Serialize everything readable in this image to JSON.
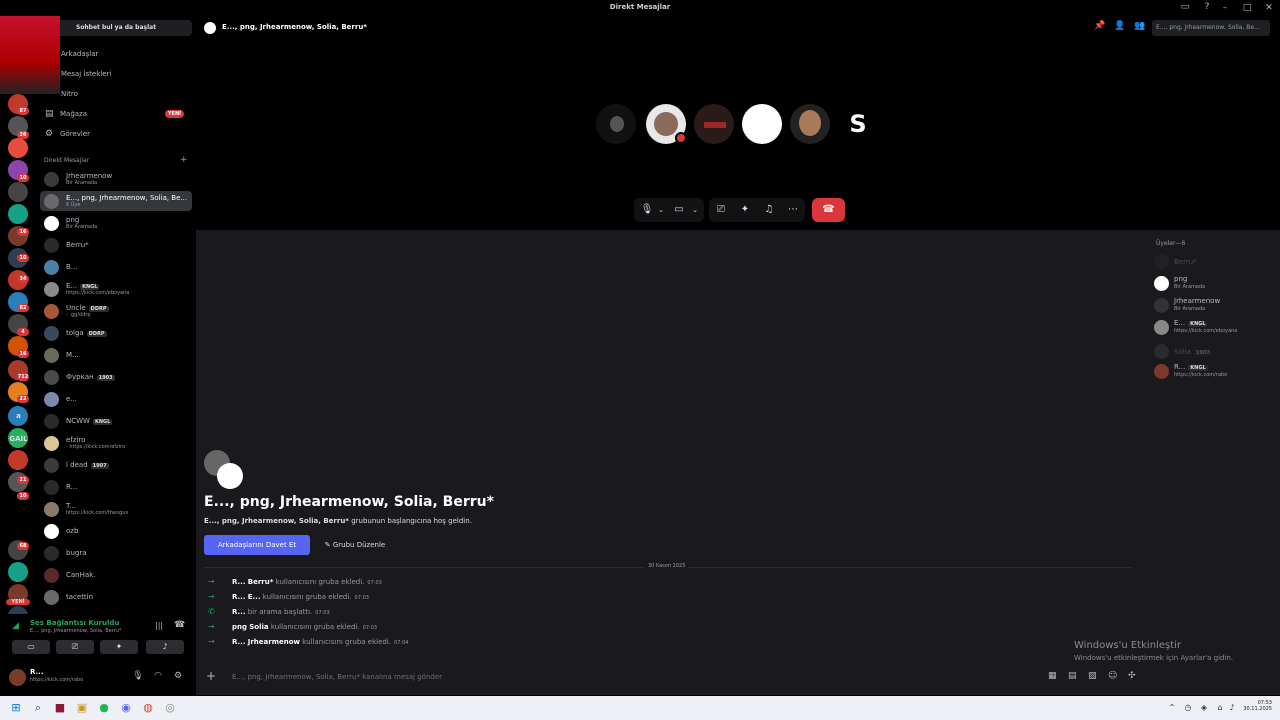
{
  "window": {
    "title": "Direkt Mesajlar"
  },
  "guild_badges": [
    "87",
    "26",
    "10",
    "16",
    "10",
    "34",
    "82",
    "4",
    "16",
    "712",
    "22",
    "21",
    "10",
    "68"
  ],
  "guild_texts": [
    "a",
    "GAİL",
    "YENİ"
  ],
  "sidebar": {
    "search": "Sohbet bul ya da başlat",
    "nav": [
      {
        "label": "Arkadaşlar",
        "icon": "friends-icon"
      },
      {
        "label": "Mesaj İstekleri",
        "icon": "mail-icon"
      },
      {
        "label": "Nitro",
        "icon": "nitro-icon"
      },
      {
        "label": "Mağaza",
        "icon": "shop-icon",
        "badge": "YENİ"
      },
      {
        "label": "Görevler",
        "icon": "quests-icon"
      }
    ],
    "dm_header": "Direkt Mesajlar",
    "dms": [
      {
        "name": "Jrhearmenow",
        "sub": "Bir Aramada",
        "color": "#3a3a3a"
      },
      {
        "name": "E..., png, Jrhearmenow, Solia, Be...",
        "sub": "6 Üye",
        "color": "#6a6a6a"
      },
      {
        "name": "png",
        "sub": "Bir Aramada",
        "color": "#ffffff"
      },
      {
        "name": "Berru*",
        "sub": "",
        "color": "#2a2a2a"
      },
      {
        "name": "B...",
        "sub": "",
        "color": "#4a7fa8"
      },
      {
        "name": "E...",
        "tag": "KNGL",
        "sub": "https://kick.com/eboyana",
        "color": "#8a8a8a"
      },
      {
        "name": "Uncle",
        "tag": "DDRP",
        "sub": "- .gg/ddrp",
        "color": "#a8563a"
      },
      {
        "name": "tolga",
        "tag": "DDRP",
        "sub": "",
        "color": "#3a4a5a"
      },
      {
        "name": "M...",
        "sub": "",
        "color": "#6a6a5a"
      },
      {
        "name": "Фуркан",
        "tag": "1903",
        "sub": "",
        "color": "#4a4a4a"
      },
      {
        "name": "e...",
        "sub": "",
        "color": "#7a8aa8"
      },
      {
        "name": "NCWW",
        "tag": "KNGL",
        "sub": "",
        "color": "#2a2a2a"
      },
      {
        "name": "efziro",
        "sub": "- https://kick.com/efziro",
        "color": "#d8c898"
      },
      {
        "name": "l dead",
        "tag": "1907",
        "sub": "",
        "color": "#3a3a3a"
      },
      {
        "name": "R...",
        "sub": "",
        "color": "#2a2a2a"
      },
      {
        "name": "T...",
        "sub": "https://kick.com/theogux",
        "color": "#8a7a6a"
      },
      {
        "name": "ozb",
        "sub": "",
        "color": "#ffffff"
      },
      {
        "name": "bugra",
        "sub": "",
        "color": "#2a2a2a"
      },
      {
        "name": "CanHak.",
        "sub": "",
        "color": "#5a2a2a"
      },
      {
        "name": "tacettin",
        "sub": "",
        "color": "#6a6a6a"
      }
    ]
  },
  "voice": {
    "title": "Ses Bağlantısı Kuruldu",
    "sub": "E..., png, Jrhearmenow, Solia, Berru*"
  },
  "user": {
    "name": "R...",
    "sub": "https://kick.com/rabo"
  },
  "topbar": {
    "title": "E..., png, Jrhearmenow, Solia, Berru*",
    "search": "E..., png, Jrhearmenow, Solia, Be..."
  },
  "call": {
    "avatars": [
      "#444",
      "#e0e0e0",
      "#3a1a1a",
      "#ffffff",
      "#6a4a3a",
      "#000"
    ],
    "s_letter": "S"
  },
  "welcome": {
    "title": "E..., png, Jrhearmenow, Solia, Berru*",
    "sub_bold": "E..., png, Jrhearmenow, Solia, Berru*",
    "sub_rest": " grubunun başlangıcına hoş geldin.",
    "invite": "Arkadaşlarını Davet Et",
    "edit": "Grubu Düzenle"
  },
  "date_divider": "30 Kasım 2025",
  "system_messages": [
    {
      "icon": "→",
      "a": "R...",
      "b": "Berru*",
      "text": "kullanıcısını gruba ekledi.",
      "time": "07:03"
    },
    {
      "icon": "→",
      "a": "R...",
      "b": "E...",
      "text": "kullanıcısını gruba ekledi.",
      "time": "07:03"
    },
    {
      "icon": "✆",
      "a": "R...",
      "b": "",
      "text": "bir arama başlattı.",
      "time": "07:03"
    },
    {
      "icon": "→",
      "a": "png",
      "b": "Solia",
      "text": "kullanıcısını gruba ekledi.",
      "time": "07:03"
    },
    {
      "icon": "→",
      "a": "R...",
      "b": "Jrhearmenow",
      "text": "kullanıcısını gruba ekledi.",
      "time": "07:04"
    }
  ],
  "input_placeholder": "E..., png, Jrhearmenow, Solia, Berru* kanalına mesaj gönder",
  "members": {
    "header": "Üyeler—6",
    "list": [
      {
        "name": "Berru*",
        "sub": "",
        "offline": true,
        "color": "#333"
      },
      {
        "name": "png",
        "sub": "Bir Aramada",
        "offline": false,
        "color": "#fff"
      },
      {
        "name": "Jrhearmenow",
        "sub": "Bir Aramada",
        "offline": false,
        "color": "#333"
      },
      {
        "name": "E...",
        "tag": "KNGL",
        "sub": "https://kick.com/eboyana",
        "offline": false,
        "color": "#888"
      },
      {
        "name": "Solia",
        "tag": "1907",
        "sub": "",
        "offline": true,
        "color": "#555"
      },
      {
        "name": "R...",
        "tag": "KNGL",
        "sub": "https://kick.com/rabo",
        "offline": false,
        "color": "#7a3a2a"
      }
    ]
  },
  "windows_activation": {
    "title": "Windows'u Etkinleştir",
    "sub": "Windows'u etkinleştirmek için Ayarlar'a gidin."
  },
  "clock": {
    "time": "07:53",
    "date": "30.11.2025"
  }
}
